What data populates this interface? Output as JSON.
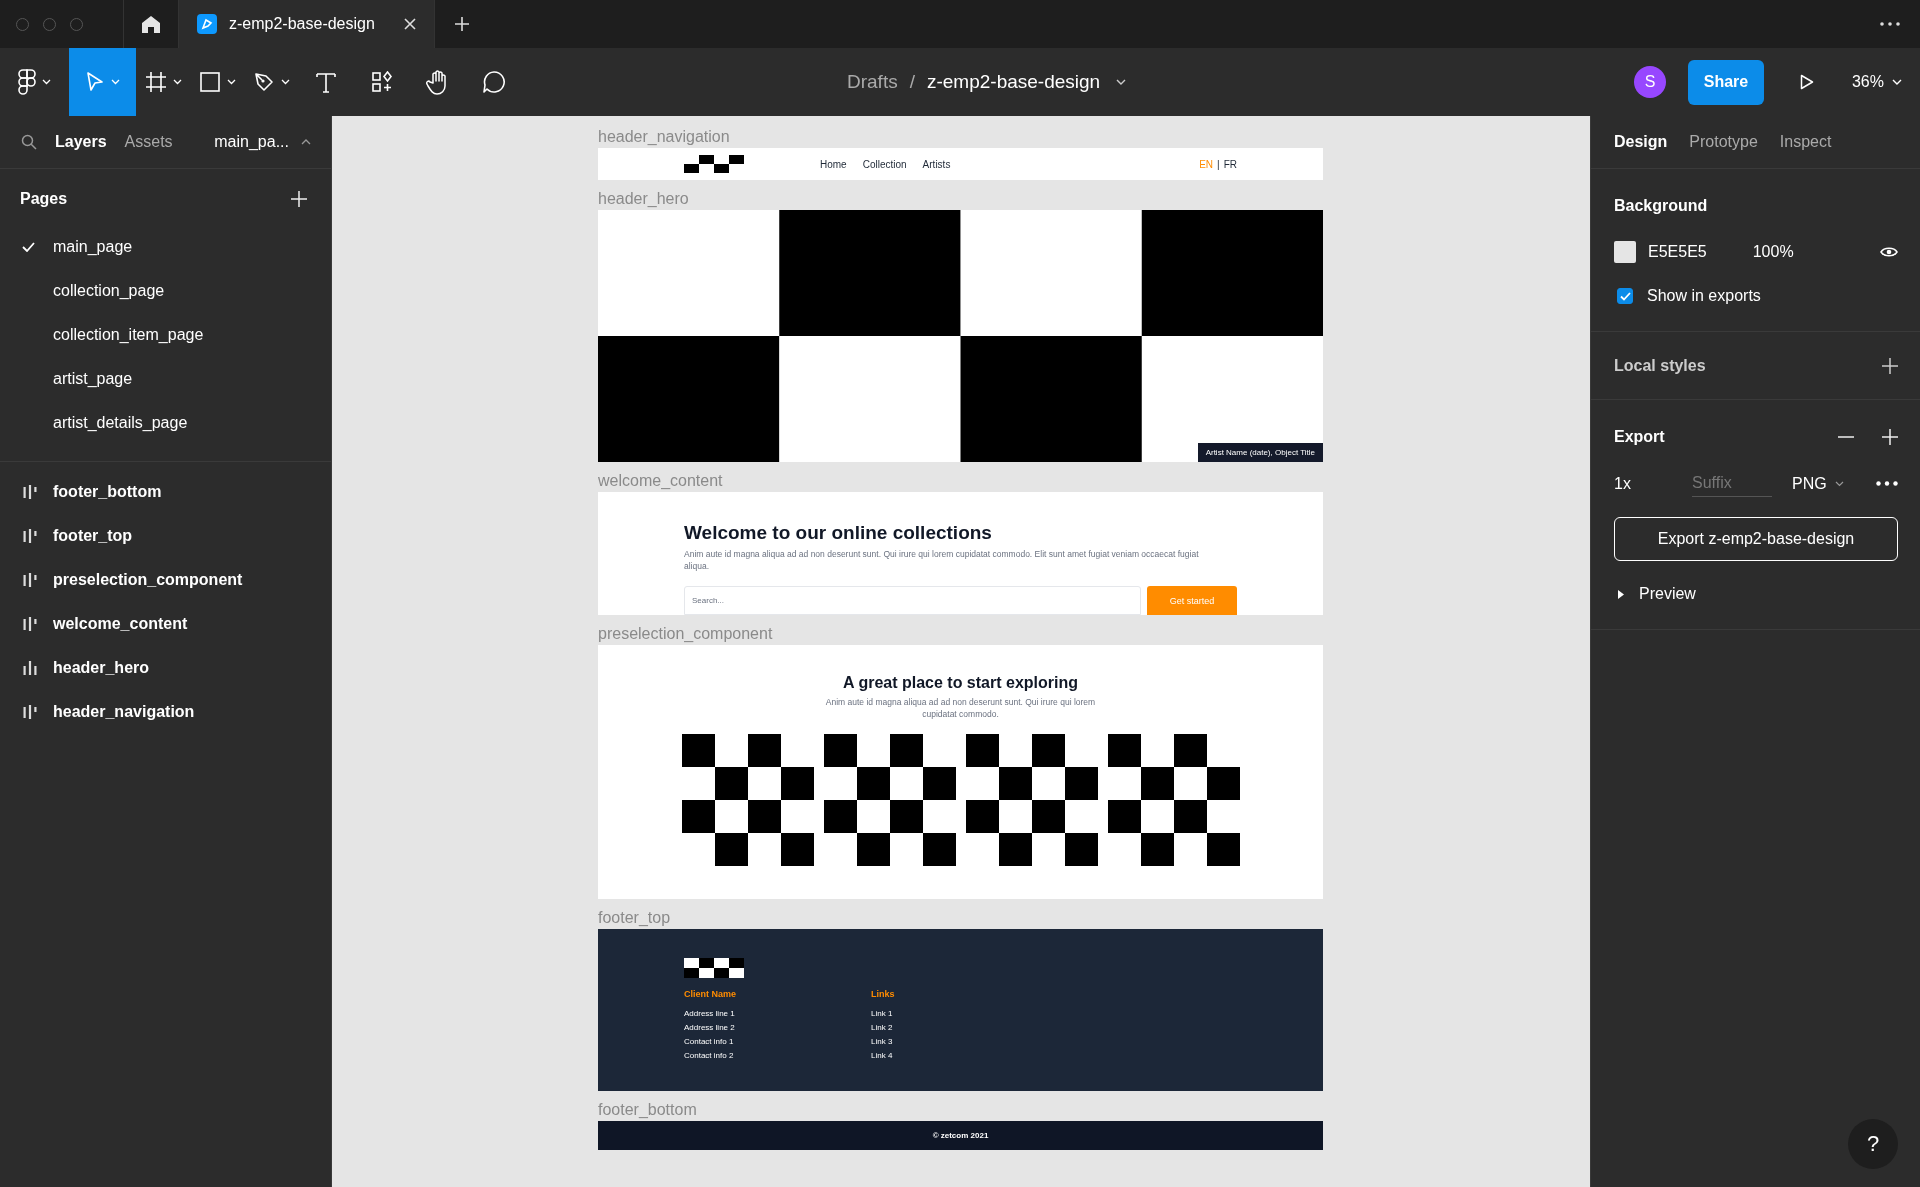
{
  "window": {
    "tabs": [
      {
        "label": "z-emp2-base-design",
        "selected": true
      }
    ]
  },
  "toolbar": {
    "tools": [
      {
        "kind": "main-menu",
        "selected": false
      },
      {
        "kind": "move",
        "selected": true
      },
      {
        "kind": "frame",
        "selected": false
      },
      {
        "kind": "shape",
        "selected": false
      },
      {
        "kind": "pen",
        "selected": false
      },
      {
        "kind": "text",
        "selected": false
      },
      {
        "kind": "resources",
        "selected": false
      },
      {
        "kind": "hand",
        "selected": false
      },
      {
        "kind": "comment",
        "selected": false
      }
    ],
    "breadcrumb": {
      "folder": "Drafts",
      "separator": "/",
      "file": "z-emp2-base-design"
    },
    "avatar": "S",
    "share": "Share",
    "zoom": "36%"
  },
  "left_panel": {
    "tabs": [
      {
        "label": "Layers",
        "selected": true
      },
      {
        "label": "Assets",
        "selected": false
      }
    ],
    "page_selector": "main_pa...",
    "pages_title": "Pages",
    "pages": [
      {
        "name": "main_page",
        "selected": true
      },
      {
        "name": "collection_page",
        "selected": false
      },
      {
        "name": "collection_item_page",
        "selected": false
      },
      {
        "name": "artist_page",
        "selected": false
      },
      {
        "name": "artist_details_page",
        "selected": false
      }
    ],
    "layers": [
      {
        "name": "footer_bottom",
        "kind": "columns"
      },
      {
        "name": "footer_top",
        "kind": "columns"
      },
      {
        "name": "preselection_component",
        "kind": "columns"
      },
      {
        "name": "welcome_content",
        "kind": "columns"
      },
      {
        "name": "header_hero",
        "kind": "rows"
      },
      {
        "name": "header_navigation",
        "kind": "columns"
      }
    ]
  },
  "canvas": {
    "frames": [
      {
        "label": "header_navigation",
        "kind": "navigation",
        "links": [
          "Home",
          "Collection",
          "Artists"
        ],
        "languages": [
          {
            "code": "EN",
            "selected": true
          },
          {
            "code": "FR",
            "selected": false
          }
        ],
        "separator": "|"
      },
      {
        "label": "header_hero",
        "kind": "hero",
        "caption": "Artist Name (date), Object Title"
      },
      {
        "label": "welcome_content",
        "kind": "welcome",
        "title": "Welcome to our online collections",
        "text": "Anim aute id magna aliqua ad ad non deserunt sunt. Qui irure qui lorem cupidatat commodo. Elit sunt amet fugiat veniam occaecat fugiat aliqua.",
        "search": {
          "placeholder": "Search..."
        },
        "button": "Get started"
      },
      {
        "label": "preselection_component",
        "kind": "preselection",
        "title": "A great place to start exploring",
        "text": "Anim aute id magna aliqua ad ad non deserunt sunt. Qui irure qui lorem cupidatat commodo."
      },
      {
        "label": "footer_top",
        "kind": "footer-top",
        "columns": [
          {
            "heading": "Client Name",
            "lines": [
              "Address line 1",
              "Address line 2",
              "Contact info 1",
              "Contact info 2"
            ]
          },
          {
            "heading": "Links",
            "lines": [
              "Link 1",
              "Link 2",
              "Link 3",
              "Link 4"
            ]
          }
        ]
      },
      {
        "label": "footer_bottom",
        "kind": "footer-bottom",
        "copyright": "© zetcom 2021"
      }
    ]
  },
  "design_panel": {
    "tabs": [
      {
        "label": "Design",
        "selected": true
      },
      {
        "label": "Prototype",
        "selected": false
      },
      {
        "label": "Inspect",
        "selected": false
      }
    ],
    "background": {
      "title": "Background",
      "color": "E5E5E5",
      "opacity": "100%",
      "show_in_exports": {
        "label": "Show in exports",
        "checked": true
      }
    },
    "local_styles": {
      "title": "Local styles"
    },
    "export": {
      "title": "Export",
      "scale": "1x",
      "suffix": {
        "placeholder": "Suffix"
      },
      "format": "PNG",
      "button": "Export z-emp2-base-design",
      "preview": {
        "label": "Preview",
        "expanded": false
      }
    }
  },
  "help": "?"
}
